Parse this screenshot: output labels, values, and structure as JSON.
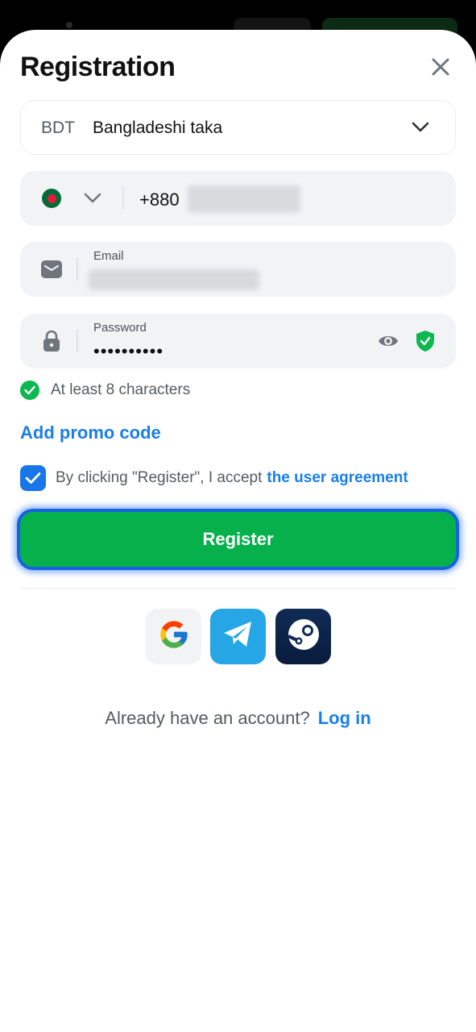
{
  "modal": {
    "title": "Registration",
    "close_icon": "close-icon"
  },
  "currency": {
    "code": "BDT",
    "name": "Bangladeshi taka",
    "icon": "chevron-down-icon"
  },
  "phone": {
    "flag_icon": "bangladesh-flag-icon",
    "prefix": "+880"
  },
  "email": {
    "label": "Email",
    "icon": "envelope-icon"
  },
  "password": {
    "label": "Password",
    "value": "••••••••••",
    "icon": "lock-icon",
    "show_icon": "eye-icon",
    "strength_icon": "shield-check-icon"
  },
  "hint": {
    "text": "At least 8 characters"
  },
  "promo": {
    "label": "Add promo code"
  },
  "agreement": {
    "checked": true,
    "text": "By clicking \"Register\", I accept",
    "link": "the user agreement"
  },
  "register_button": {
    "label": "Register"
  },
  "social": [
    "google-icon",
    "telegram-icon",
    "steam-icon"
  ],
  "footer": {
    "question": "Already have an account?",
    "login_link": "Log in"
  },
  "colors": {
    "accent_blue": "#1a7fe6",
    "register_green": "#06b14c",
    "check_green": "#0cb84f",
    "field_bg": "#f2f3f5"
  }
}
